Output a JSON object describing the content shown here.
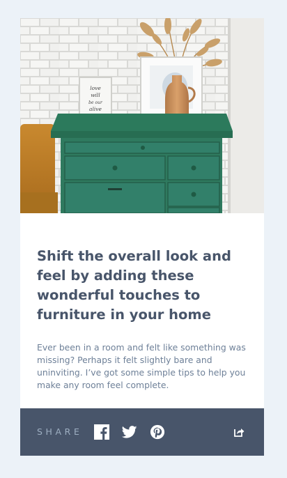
{
  "article": {
    "title": "Shift the overall look and feel by adding these wonderful touches to furniture in your home",
    "description": "Ever been in a room and felt like something was missing? Perhaps it felt slightly bare and uninviting. I’ve got some simple tips to help you make any room feel complete."
  },
  "hero": {
    "frame_text": [
      "love",
      "will",
      "be our",
      "alive"
    ]
  },
  "share": {
    "label": "SHARE",
    "icons": [
      "facebook-icon",
      "twitter-icon",
      "pinterest-icon",
      "share-icon"
    ]
  },
  "colors": {
    "page_background": "#ecf2f8",
    "title": "#48556a",
    "body_text": "#6e8098",
    "share_bar": "#48556a",
    "share_label": "#9eafc2",
    "dresser": "#2f7a5f"
  }
}
